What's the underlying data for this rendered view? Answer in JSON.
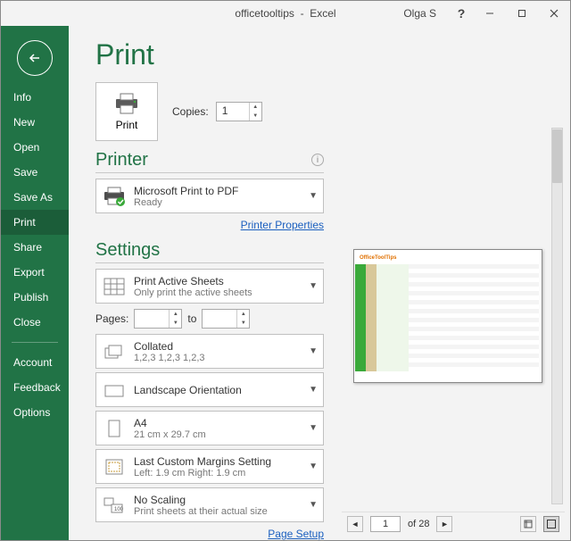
{
  "titlebar": {
    "doc": "officetooltips",
    "app": "Excel",
    "user": "Olga S"
  },
  "sidebar": {
    "items": [
      "Info",
      "New",
      "Open",
      "Save",
      "Save As",
      "Print",
      "Share",
      "Export",
      "Publish",
      "Close"
    ],
    "footer": [
      "Account",
      "Feedback",
      "Options"
    ],
    "active_index": 5
  },
  "page": {
    "title": "Print",
    "print_button": "Print",
    "copies_label": "Copies:",
    "copies_value": "1"
  },
  "printer_section": {
    "heading": "Printer",
    "name": "Microsoft Print to PDF",
    "status": "Ready",
    "props_link": "Printer Properties"
  },
  "settings_section": {
    "heading": "Settings",
    "print_what": {
      "line1": "Print Active Sheets",
      "line2": "Only print the active sheets"
    },
    "pages_label": "Pages:",
    "pages_to": "to",
    "pages_from": "",
    "pages_to_val": "",
    "collated": {
      "line1": "Collated",
      "line2": "1,2,3    1,2,3    1,2,3"
    },
    "orientation": {
      "line1": "Landscape Orientation",
      "line2": ""
    },
    "paper": {
      "line1": "A4",
      "line2": "21 cm x 29.7 cm"
    },
    "margins": {
      "line1": "Last Custom Margins Setting",
      "line2": "Left:  1.9 cm    Right:  1.9 cm"
    },
    "scaling": {
      "line1": "No Scaling",
      "line2": "Print sheets at their actual size"
    },
    "setup_link": "Page Setup"
  },
  "preview": {
    "page_current": "1",
    "page_total": "of 28",
    "sheet_title": "OfficeToolTips"
  },
  "colors": {
    "accent": "#217346"
  }
}
